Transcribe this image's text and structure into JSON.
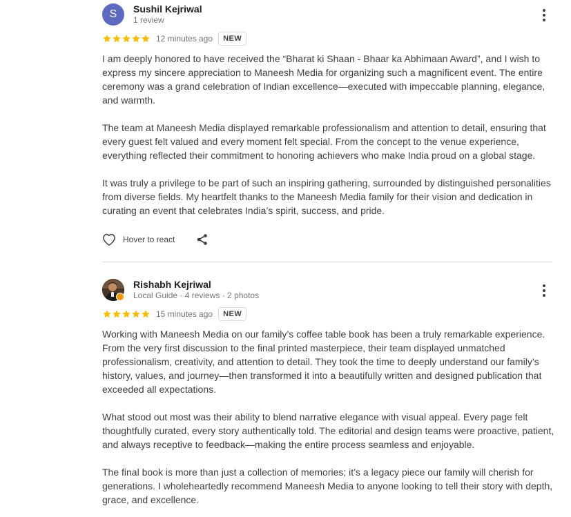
{
  "colors": {
    "star": "#fbbc04",
    "avatar_bg": "#5c6bc0",
    "text_secondary": "#70757a",
    "text_body": "#3c4043",
    "divider": "#dadce0",
    "guide_badge": "#f29900"
  },
  "reviews": [
    {
      "avatar_letter": "S",
      "name": "Sushil Kejriwal",
      "meta": "1 review",
      "rating": 5,
      "time_ago": "12 minutes ago",
      "badge": "NEW",
      "paragraphs": [
        "I am deeply honored to have received the “Bharat ki Shaan - Bhaar ka Abhimaan Award”, and I wish to express my sincere appreciation to Maneesh Media for organizing such a magnificent event. The entire ceremony was a grand celebration of Indian excellence—executed with impeccable planning, elegance, and warmth.",
        "The team at Maneesh Media displayed remarkable professionalism and attention to detail, ensuring that every guest felt valued and every moment felt special. From the concept to the venue experience, everything reflected their commitment to honoring achievers who make India proud on a global stage.",
        "It was truly a privilege to be part of such an inspiring gathering, surrounded by distinguished personalities from diverse fields. My heartfelt thanks to the Maneesh Media family for their vision and dedication in curating an event that celebrates India’s spirit, success, and pride."
      ],
      "react_label": "Hover to react",
      "icons": {
        "more": "more-vert-icon",
        "react": "heart-outline-icon",
        "share": "share-icon"
      }
    },
    {
      "name": "Rishabh Kejriwal",
      "meta": "Local Guide · 4 reviews · 2 photos",
      "rating": 5,
      "time_ago": "15 minutes ago",
      "badge": "NEW",
      "paragraphs": [
        "Working with Maneesh Media on our family’s coffee table book has been a truly remarkable experience. From the very first discussion to the final printed masterpiece, their team displayed unmatched professionalism, creativity, and attention to detail. They took the time to deeply understand our family’s history, values, and journey—then transformed it into a beautifully written and designed publication that exceeded all expectations.",
        "What stood out most was their ability to blend narrative elegance with visual appeal. Every page felt thoughtfully curated, every story authentically told. The editorial and design teams were proactive, patient, and always receptive to feedback—making the entire process seamless and enjoyable.",
        "The final book is more than just a collection of memories; it’s a legacy piece our family will cherish for generations. I wholeheartedly recommend Maneesh Media to anyone looking to tell their story with depth, grace, and excellence."
      ],
      "icons": {
        "more": "more-vert-icon",
        "avatar": "profile-photo",
        "guide_badge": "local-guide-badge-icon"
      }
    }
  ]
}
